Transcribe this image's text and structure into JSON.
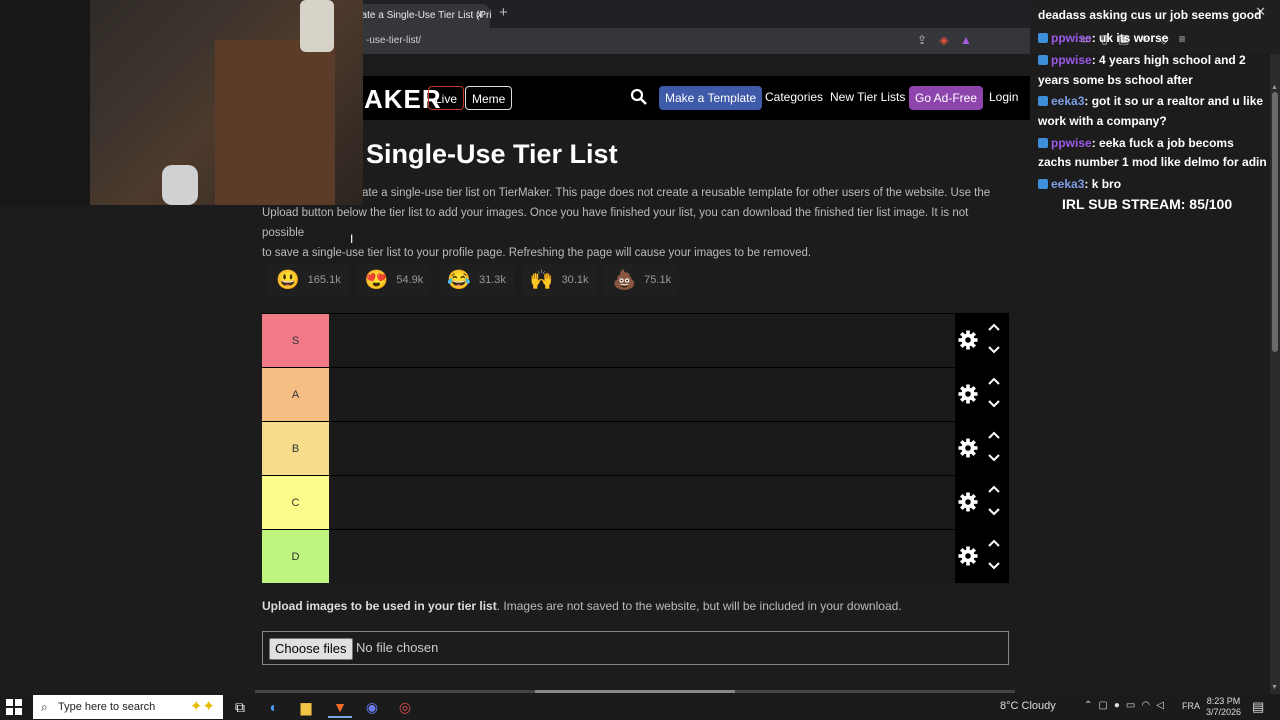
{
  "browser": {
    "tab_title": "eate a Single-Use Tier List (Pri",
    "url": "-use-tier-list/"
  },
  "site": {
    "logo": "AKER",
    "nav": {
      "live": "Live",
      "meme": "Meme",
      "make_template": "Make a Template",
      "categories": "Categories",
      "new_tier_lists": "New Tier Lists",
      "ad_free": "Go Ad-Free",
      "login": "Login"
    },
    "colors": {
      "live_border": "#c0392b",
      "make_bg": "#3f5aa8",
      "adfree_bg": "#8e44ad"
    }
  },
  "page": {
    "title": "n Single-Use Tier List",
    "description": [
      "ate a single-use tier list on TierMaker. This page does not create a reusable template for other users of the website. Use the",
      "Upload button below the tier list to add your images. Once you have finished your list, you can download the finished tier list image. It is not possible",
      "to save a single-use tier list to your profile page. Refreshing the page will cause your images to be removed."
    ],
    "reactions": [
      {
        "emoji": "😃",
        "count": "165.1k"
      },
      {
        "emoji": "😍",
        "count": "54.9k"
      },
      {
        "emoji": "😂",
        "count": "31.3k"
      },
      {
        "emoji": "🙌",
        "count": "30.1k"
      },
      {
        "emoji": "💩",
        "count": "75.1k"
      }
    ],
    "tiers": [
      {
        "label": "S",
        "color": "#f07b86"
      },
      {
        "label": "A",
        "color": "#f5be82"
      },
      {
        "label": "B",
        "color": "#f7dc8c"
      },
      {
        "label": "C",
        "color": "#fcfc8a"
      },
      {
        "label": "D",
        "color": "#bff47f"
      }
    ],
    "upload": {
      "bold": "Upload images to be used in your tier list",
      "rest": ". Images are not saved to the website, but will be included in your download.",
      "button": "Choose files",
      "status": "No file chosen"
    }
  },
  "chat": {
    "messages": [
      {
        "user": "",
        "text": "deadass asking cus ur job seems good"
      },
      {
        "user": "ppwise",
        "text": ": uk its worse"
      },
      {
        "user": "ppwise",
        "text": ": 4 years high school and 2"
      },
      {
        "user": "",
        "text": "years some bs school after"
      },
      {
        "user": "eeka3",
        "text": ": got it so ur a realtor and u like"
      },
      {
        "user": "",
        "text": "work with a company?"
      },
      {
        "user": "ppwise",
        "text": ": eeka fuck a job becoms"
      },
      {
        "user": "",
        "text": "zachs number 1 mod like delmo for adin"
      },
      {
        "user": "eeka3",
        "text": ": k bro"
      }
    ],
    "substream": "IRL SUB STREAM: 85/100"
  },
  "taskbar": {
    "search_placeholder": "Type here to search",
    "weather": "8°C  Cloudy",
    "lang": "FRA",
    "time": "8:23 PM",
    "date": "3/7/2026"
  }
}
